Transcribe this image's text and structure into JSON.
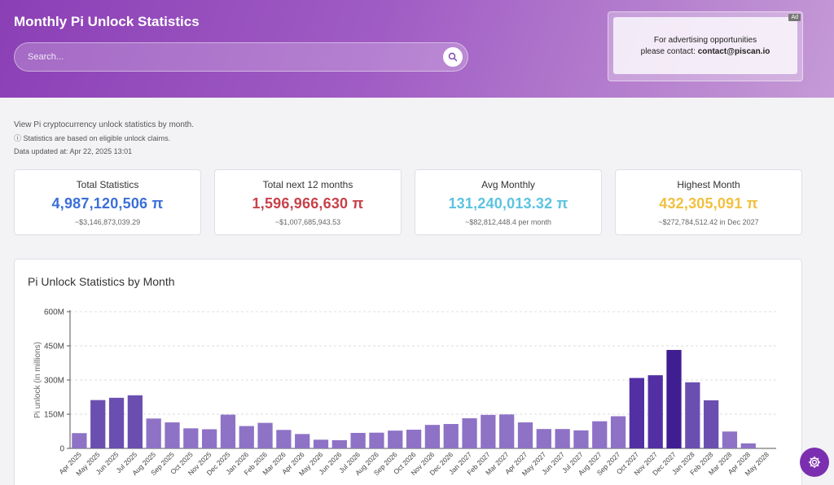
{
  "header": {
    "title": "Monthly Pi Unlock Statistics",
    "search_placeholder": "Search..."
  },
  "ad": {
    "line1": "For advertising opportunities",
    "line2_prefix": "please contact: ",
    "email": "contact@piscan.io",
    "tag": "Ad"
  },
  "intro": {
    "description": "View Pi cryptocurrency unlock statistics by month.",
    "note": "ⓘ Statistics are based on eligible unlock claims.",
    "updated": "Data updated at: Apr 22, 2025 13:01"
  },
  "stats": [
    {
      "label": "Total Statistics",
      "value": "4,987,120,506 π",
      "sub": "~$3,146,873,039.29",
      "color": "#3b6fd8"
    },
    {
      "label": "Total next 12 months",
      "value": "1,596,966,630 π",
      "sub": "~$1,007,685,943.53",
      "color": "#c7424a"
    },
    {
      "label": "Avg Monthly",
      "value": "131,240,013.32 π",
      "sub": "~$82,812,448.4 per month",
      "color": "#5bc3e0"
    },
    {
      "label": "Highest Month",
      "value": "432,305,091 π",
      "sub": "~$272,784,512.42 in Dec 2027",
      "color": "#f0c040"
    }
  ],
  "chart_title": "Pi Unlock Statistics by Month",
  "chart_data": {
    "type": "bar",
    "ylabel": "Pi unlock (in millions)",
    "ylim": [
      0,
      600
    ],
    "yticks": [
      "0",
      "150M",
      "300M",
      "450M",
      "600M"
    ],
    "grid": true,
    "categories": [
      "Apr 2025",
      "May 2025",
      "Jun 2025",
      "Jul 2025",
      "Aug 2025",
      "Sep 2025",
      "Oct 2025",
      "Nov 2025",
      "Dec 2025",
      "Jan 2026",
      "Feb 2026",
      "Mar 2026",
      "Apr 2026",
      "May 2026",
      "Jun 2026",
      "Jul 2026",
      "Aug 2026",
      "Sep 2026",
      "Oct 2026",
      "Nov 2026",
      "Dec 2026",
      "Jan 2027",
      "Feb 2027",
      "Mar 2027",
      "Apr 2027",
      "May 2027",
      "Jun 2027",
      "Jul 2027",
      "Aug 2027",
      "Sep 2027",
      "Oct 2027",
      "Nov 2027",
      "Dec 2027",
      "Jan 2028",
      "Feb 2028",
      "Mar 2028",
      "Apr 2028",
      "May 2028"
    ],
    "values": [
      67,
      212,
      222,
      233,
      131,
      114,
      88,
      84,
      148,
      98,
      112,
      81,
      63,
      38,
      36,
      68,
      69,
      78,
      82,
      103,
      107,
      132,
      147,
      149,
      114,
      85,
      85,
      79,
      119,
      141,
      309,
      321,
      432,
      290,
      211,
      74,
      22,
      0
    ]
  },
  "colors": {
    "bar_light": "#8e72c6",
    "bar_mid": "#6a4fb0",
    "bar_dark": "#5230a4",
    "bar_darkest": "#3f1e92"
  }
}
